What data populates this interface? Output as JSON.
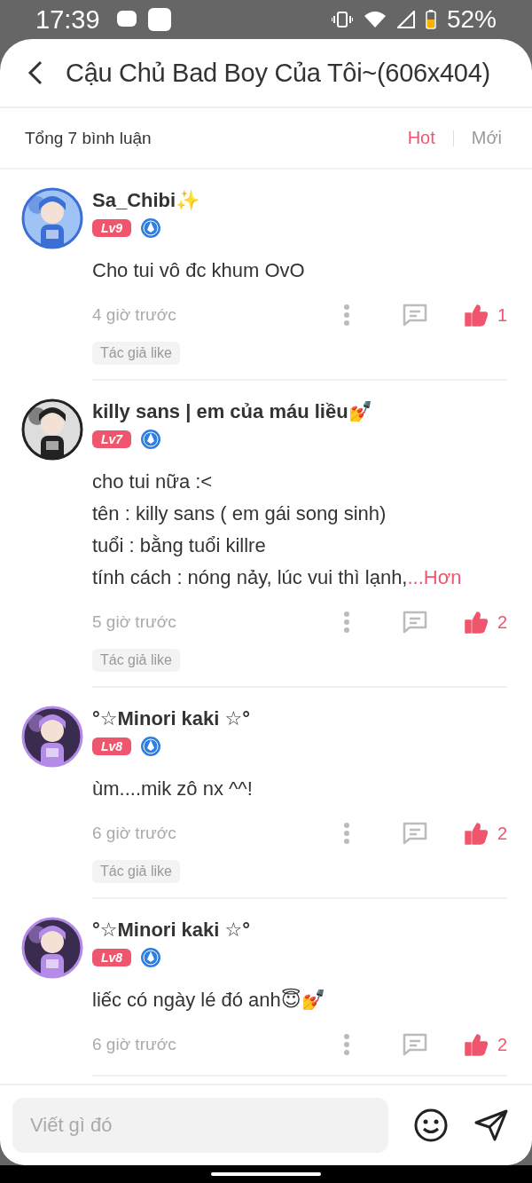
{
  "status_bar": {
    "time": "17:39",
    "battery": "52%"
  },
  "header": {
    "title": "Cậu Chủ Bad Boy Của Tôi~(606x404)"
  },
  "summary": {
    "count_label": "Tổng 7 bình luận",
    "sort_tabs": [
      {
        "label": "Hot",
        "selected": true
      },
      {
        "label": "Mới",
        "selected": false
      }
    ]
  },
  "comments": [
    {
      "author": "Sa_Chibi✨",
      "level": "Lv9",
      "lines": [
        "Cho tui vô đc khum OvO"
      ],
      "time": "4 giờ trước",
      "likes": "1",
      "liked": true,
      "author_badge": "Tác giả like"
    },
    {
      "author": "killy sans | em của máu liều💅",
      "level": "Lv7",
      "lines": [
        "cho tui nữa :<",
        "tên : killy sans ( em gái song sinh)",
        "tuổi : bằng tuổi killre",
        "tính cách : nóng nảy, lúc vui thì lạnh,"
      ],
      "more_link": "...Hơn",
      "time": "5 giờ trước",
      "likes": "2",
      "liked": true,
      "author_badge": "Tác giả like"
    },
    {
      "author": "°☆Minori kaki ☆°",
      "level": "Lv8",
      "lines": [
        "ùm....mik zô nx ^^!"
      ],
      "time": "6 giờ trước",
      "likes": "2",
      "liked": true,
      "author_badge": "Tác giả like"
    },
    {
      "author": "°☆Minori kaki ☆°",
      "level": "Lv8",
      "lines": [
        "liếc có ngày lé đó anh😇💅"
      ],
      "time": "6 giờ trước",
      "likes": "2",
      "liked": true
    }
  ],
  "composer": {
    "placeholder": "Viết gì đó"
  }
}
